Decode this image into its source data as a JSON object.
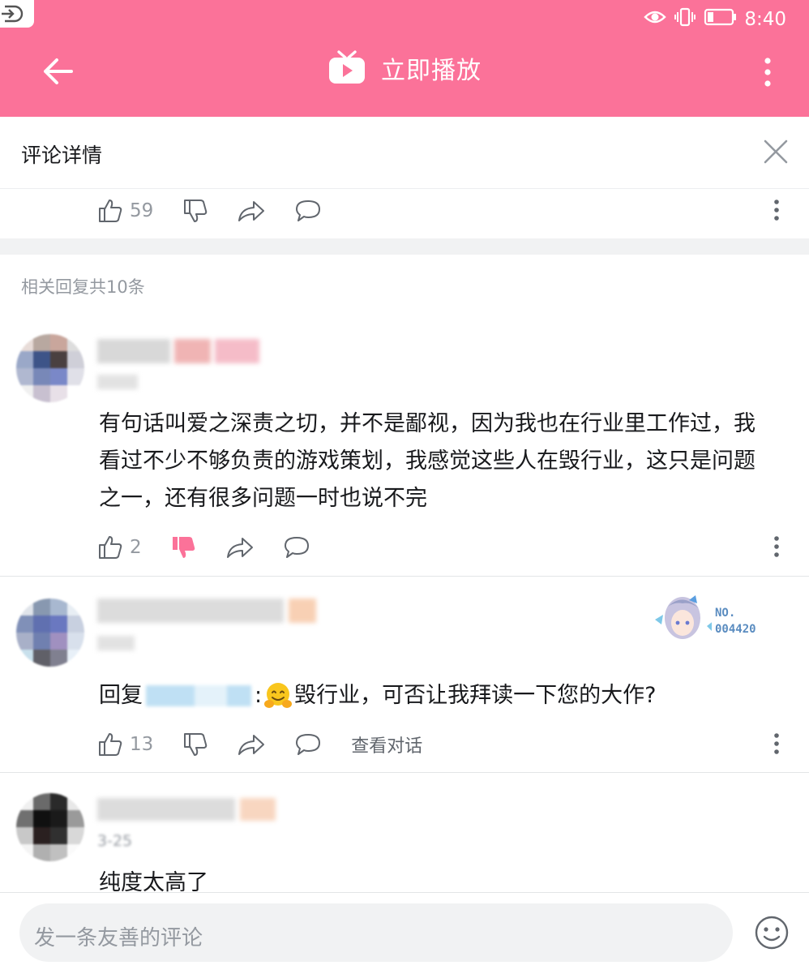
{
  "status_bar": {
    "time": "8:40"
  },
  "header": {
    "title": "立即播放"
  },
  "panel": {
    "title": "评论详情"
  },
  "root_actions": {
    "like_count": "59"
  },
  "replies": {
    "count_label": "相关回复共10条"
  },
  "comments": [
    {
      "text": "有句话叫爱之深责之切，并不是鄙视，因为我也在行业里工作过，我看过不少不够负责的游戏策划，我感觉这些人在毁行业，这只是问题之一，还有很多问题一时也说不完",
      "like_count": "2",
      "disliked": true
    },
    {
      "text_prefix": "回复",
      "text_colon": ":",
      "text_body": "毁行业，可否让我拜读一下您的大作?",
      "like_count": "13",
      "view_convo": "查看对话",
      "badge_no": "NO.",
      "badge_num": "004420"
    },
    {
      "date_partial": "3-25",
      "text": "纯度太高了"
    }
  ],
  "input": {
    "placeholder": "发一条友善的评论"
  },
  "colors": {
    "accent": "#fb7299",
    "muted": "#9499a0",
    "text": "#18191c",
    "link": "#5a9ee0"
  },
  "icons": [
    "eye-icon",
    "vibrate-icon",
    "battery-icon",
    "back-arrow-icon",
    "tv-icon",
    "more-vertical-icon",
    "close-icon",
    "thumb-up-icon",
    "thumb-down-icon",
    "share-icon",
    "comment-icon",
    "emoji-icon"
  ]
}
